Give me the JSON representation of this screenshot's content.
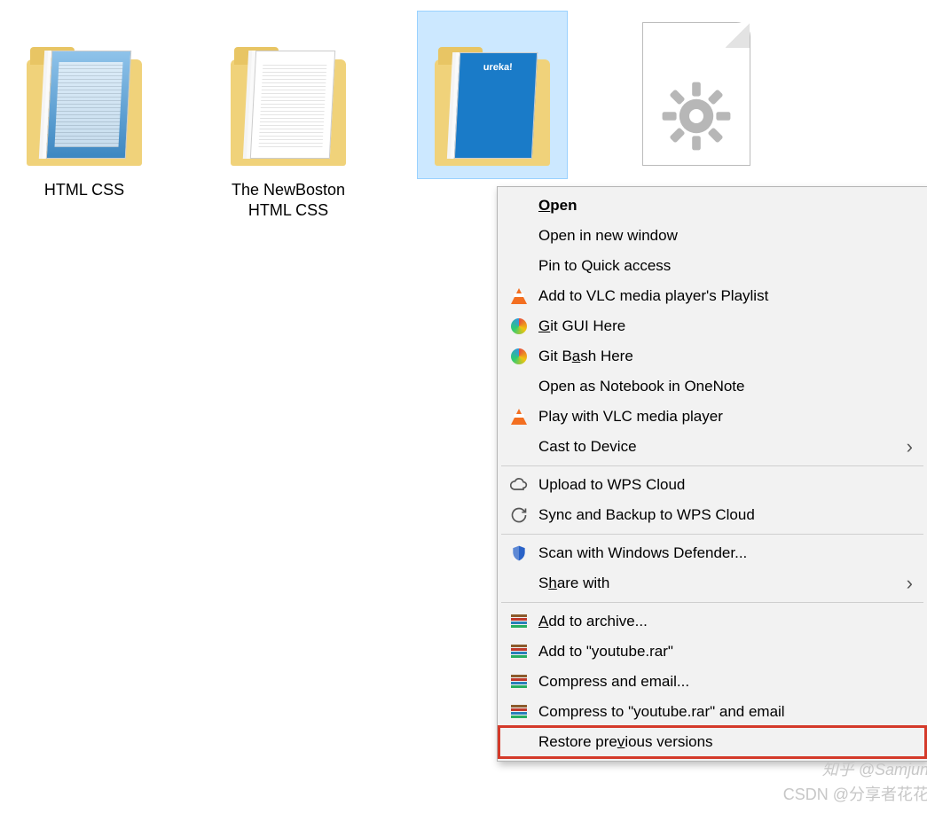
{
  "desktop": {
    "items": [
      {
        "label": "HTML CSS",
        "type": "folder",
        "selected": false,
        "preview": "win"
      },
      {
        "label": "The NewBoston HTML CSS",
        "type": "folder",
        "selected": false,
        "preview": "text"
      },
      {
        "label": "",
        "type": "folder",
        "selected": true,
        "preview": "blue",
        "preview_text": "ureka!"
      },
      {
        "label": "",
        "type": "settings-file",
        "selected": false
      },
      {
        "label": "",
        "type": "chrome-shortcut",
        "selected": false
      }
    ]
  },
  "context_menu": {
    "items": [
      {
        "label": "Open",
        "bold": true,
        "accel": "O",
        "icon": "",
        "submenu": false
      },
      {
        "label": "Open in new window",
        "accel": "",
        "icon": "",
        "submenu": false
      },
      {
        "label": "Pin to Quick access",
        "icon": "",
        "submenu": false
      },
      {
        "label": "Add to VLC media player's Playlist",
        "icon": "vlc",
        "submenu": false
      },
      {
        "label": "Git GUI Here",
        "accel": "G",
        "icon": "gitcolor",
        "submenu": false
      },
      {
        "label": "Git Bash Here",
        "accel": "a",
        "icon": "gitcolor",
        "submenu": false
      },
      {
        "label": "Open as Notebook in OneNote",
        "icon": "",
        "submenu": false
      },
      {
        "label": "Play with VLC media player",
        "icon": "vlc",
        "submenu": false
      },
      {
        "label": "Cast to Device",
        "icon": "",
        "submenu": true
      },
      {
        "sep": true
      },
      {
        "label": "Upload to WPS Cloud",
        "icon": "cloud",
        "submenu": false
      },
      {
        "label": "Sync and Backup to WPS Cloud",
        "icon": "sync",
        "submenu": false
      },
      {
        "sep": true
      },
      {
        "label": "Scan with Windows Defender...",
        "icon": "shield",
        "submenu": false
      },
      {
        "label": "Share with",
        "accel": "h",
        "icon": "",
        "submenu": true
      },
      {
        "sep": true
      },
      {
        "label": "Add to archive...",
        "accel": "A",
        "icon": "books",
        "submenu": false
      },
      {
        "label": "Add to \"youtube.rar\"",
        "icon": "books",
        "submenu": false
      },
      {
        "label": "Compress and email...",
        "icon": "books",
        "submenu": false
      },
      {
        "label": "Compress to \"youtube.rar\" and email",
        "icon": "books",
        "submenu": false
      },
      {
        "label": "Restore previous versions",
        "accel": "v",
        "icon": "",
        "highlight": true,
        "submenu": false
      }
    ]
  },
  "watermarks": {
    "line1": "知乎 @Samjun",
    "line2": "CSDN @分享者花花"
  }
}
